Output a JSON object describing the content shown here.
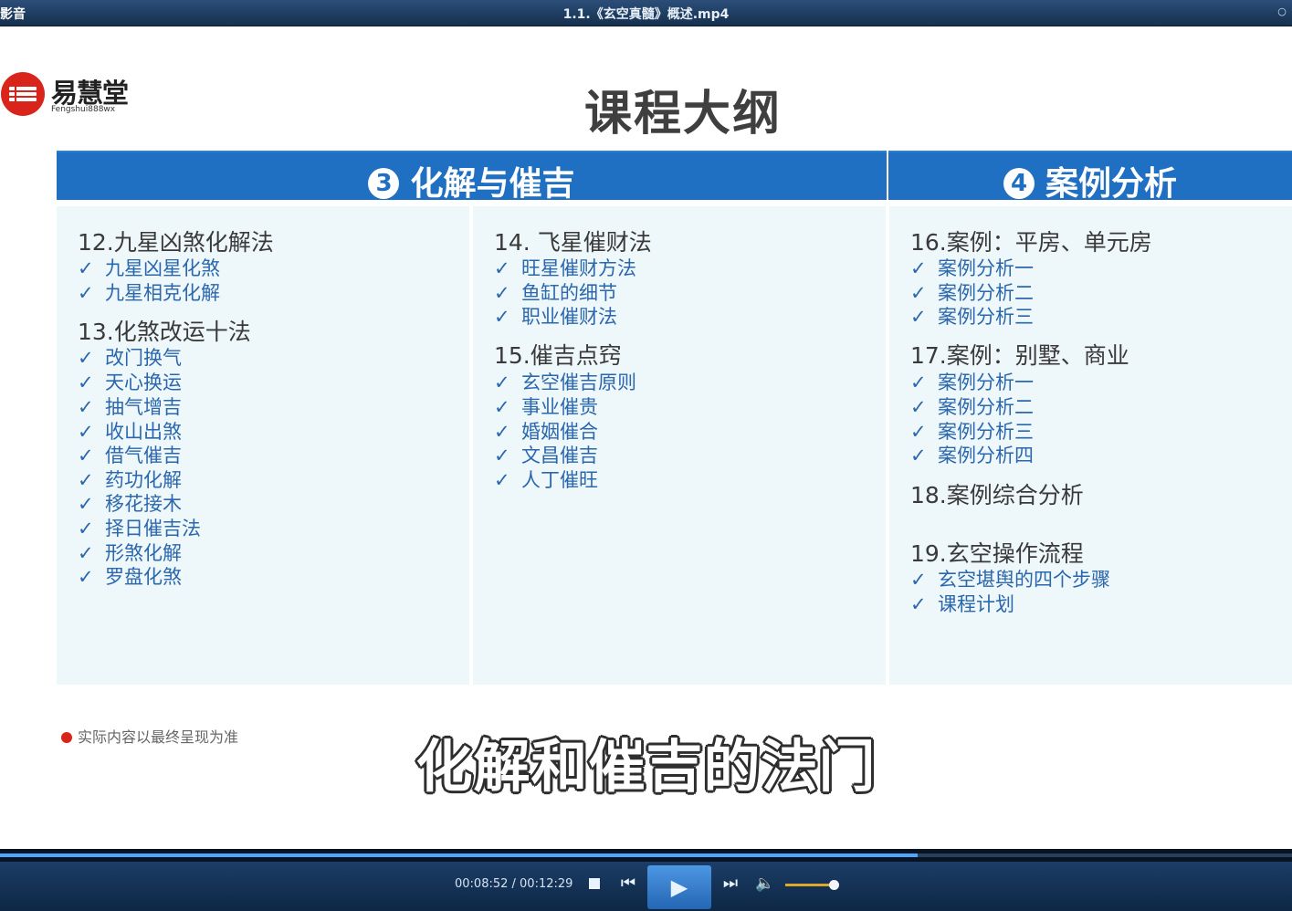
{
  "window": {
    "app_name": "影音",
    "title": "1.1.《玄空真髓》概述.mp4",
    "corner_icon": "chat-bubble-icon"
  },
  "slide": {
    "logo_name": "易慧堂",
    "logo_sub": "Fengshui888wx",
    "title": "课程大纲",
    "band3": {
      "num": "3",
      "label": "化解与催吉"
    },
    "band4": {
      "num": "4",
      "label": "案例分析"
    },
    "col1": {
      "s12": "12.九星凶煞化解法",
      "s12_items": [
        "九星凶星化煞",
        "九星相克化解"
      ],
      "s13": "13.化煞改运十法",
      "s13_items": [
        "改门换气",
        "天心换运",
        "抽气增吉",
        "收山出煞",
        "借气催吉",
        "药功化解",
        "移花接木",
        "择日催吉法",
        "形煞化解",
        "罗盘化煞"
      ]
    },
    "col2": {
      "s14": "14. 飞星催财法",
      "s14_items": [
        "旺星催财方法",
        "鱼缸的细节",
        "职业催财法"
      ],
      "s15": "15.催吉点窍",
      "s15_items": [
        "玄空催吉原则",
        "事业催贵",
        "婚姻催合",
        "文昌催吉",
        "人丁催旺"
      ]
    },
    "col3": {
      "s16": "16.案例：平房、单元房",
      "s16_items": [
        "案例分析一",
        "案例分析二",
        "案例分析三"
      ],
      "s17": "17.案例：别墅、商业",
      "s17_items": [
        "案例分析一",
        "案例分析二",
        "案例分析三",
        "案例分析四"
      ],
      "s18": "18.案例综合分析",
      "s19": "19.玄空操作流程",
      "s19_items": [
        "玄空堪舆的四个步骤",
        "课程计划"
      ]
    },
    "check_mark": "✓",
    "disclaimer": "实际内容以最终呈现为准",
    "subtitle": "化解和催吉的法门"
  },
  "player": {
    "time": "00:08:52 / 00:12:29",
    "progress": 0.71,
    "volume": 0.95,
    "accent": "#4ea6ff"
  }
}
